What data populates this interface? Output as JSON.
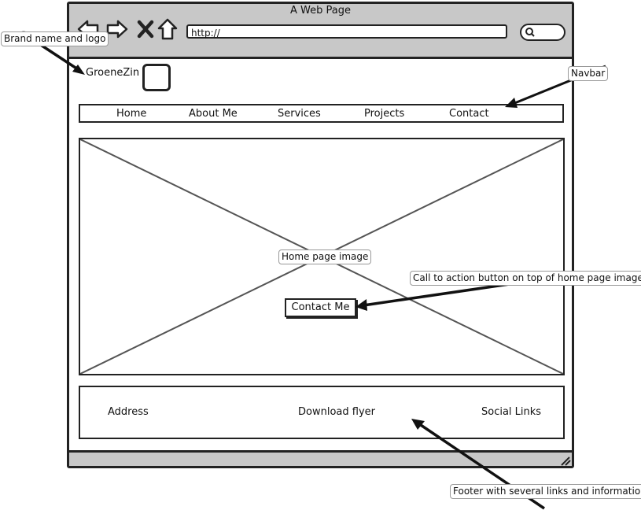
{
  "window": {
    "title": "A Web Page"
  },
  "toolbar": {
    "back_icon": "back-arrow-icon",
    "forward_icon": "forward-arrow-icon",
    "stop_icon": "close-icon",
    "home_icon": "home-icon",
    "url": "http://",
    "search_icon": "search-icon"
  },
  "brand": {
    "name": "GroeneZin",
    "logo_icon": "logo-placeholder"
  },
  "navbar": {
    "items": [
      {
        "label": "Home"
      },
      {
        "label": "About Me"
      },
      {
        "label": "Services"
      },
      {
        "label": "Projects"
      },
      {
        "label": "Contact"
      }
    ]
  },
  "hero": {
    "cta_label": "Contact Me"
  },
  "footer": {
    "items": [
      {
        "label": "Address"
      },
      {
        "label": "Download flyer"
      },
      {
        "label": "Social Links"
      }
    ]
  },
  "annotations": {
    "brand": "Brand name and logo",
    "navbar": "Navbar",
    "home_image": "Home page image",
    "cta": "Call to action button on top of home page image",
    "footer": "Footer with several links and information"
  },
  "colors": {
    "chrome": "#c8c8c8",
    "stroke": "#222222",
    "placeholder_x": "#555555"
  }
}
